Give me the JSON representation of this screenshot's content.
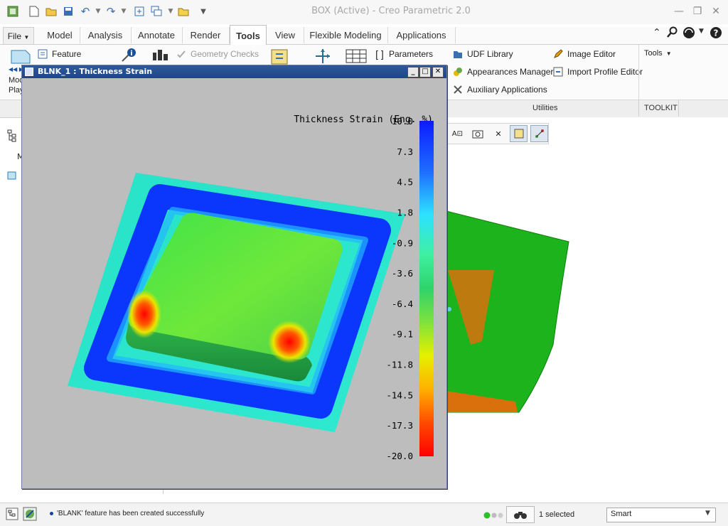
{
  "window": {
    "title": "BOX (Active) - Creo Parametric 2.0",
    "controls": [
      "minimize",
      "restore",
      "close"
    ]
  },
  "ribbon": {
    "file_tab": "File",
    "tabs": [
      "Model",
      "Analysis",
      "Annotate",
      "Render",
      "Tools",
      "View",
      "Flexible Modeling",
      "Applications"
    ],
    "active_tab": "Tools",
    "buttons": {
      "feature": "Feature",
      "geometry_checks": "Geometry Checks",
      "parameters": "Parameters",
      "udf_library": "UDF Library",
      "image_editor": "Image Editor",
      "appearances_manager": "Appearances Manager",
      "import_profile_editor": "Import Profile Editor",
      "auxiliary_applications": "Auxiliary Applications",
      "tools_dropdown": "Tools",
      "model_player_cut1": "Mod",
      "model_player_cut2": "Play"
    },
    "groups": {
      "utilities": "Utilities",
      "toolkit": "TOOLKIT"
    }
  },
  "popup": {
    "title": "BLNK_1 : Thickness Strain",
    "legend_title": "Thickness Strain (Eng. %)",
    "legend_ticks": [
      "10.0",
      "7.3",
      "4.5",
      "1.8",
      "-0.9",
      "-3.6",
      "-6.4",
      "-9.1",
      "-11.8",
      "-14.5",
      "-17.3",
      "-20.0"
    ],
    "legend_range": [
      -20.0,
      10.0
    ],
    "colors": {
      "max": "#0b1cff",
      "mid": "#2fd36a",
      "min": "#ff0000",
      "background": "#bdbdbd"
    }
  },
  "status": {
    "message": "'BLANK' feature has been created successfully",
    "selected": "1 selected",
    "filter": "Smart"
  },
  "icons": [
    "save-icon",
    "undo-icon",
    "redo-icon",
    "help-icon",
    "search-icon",
    "community-icon",
    "model-tree-icon",
    "part-icon"
  ]
}
